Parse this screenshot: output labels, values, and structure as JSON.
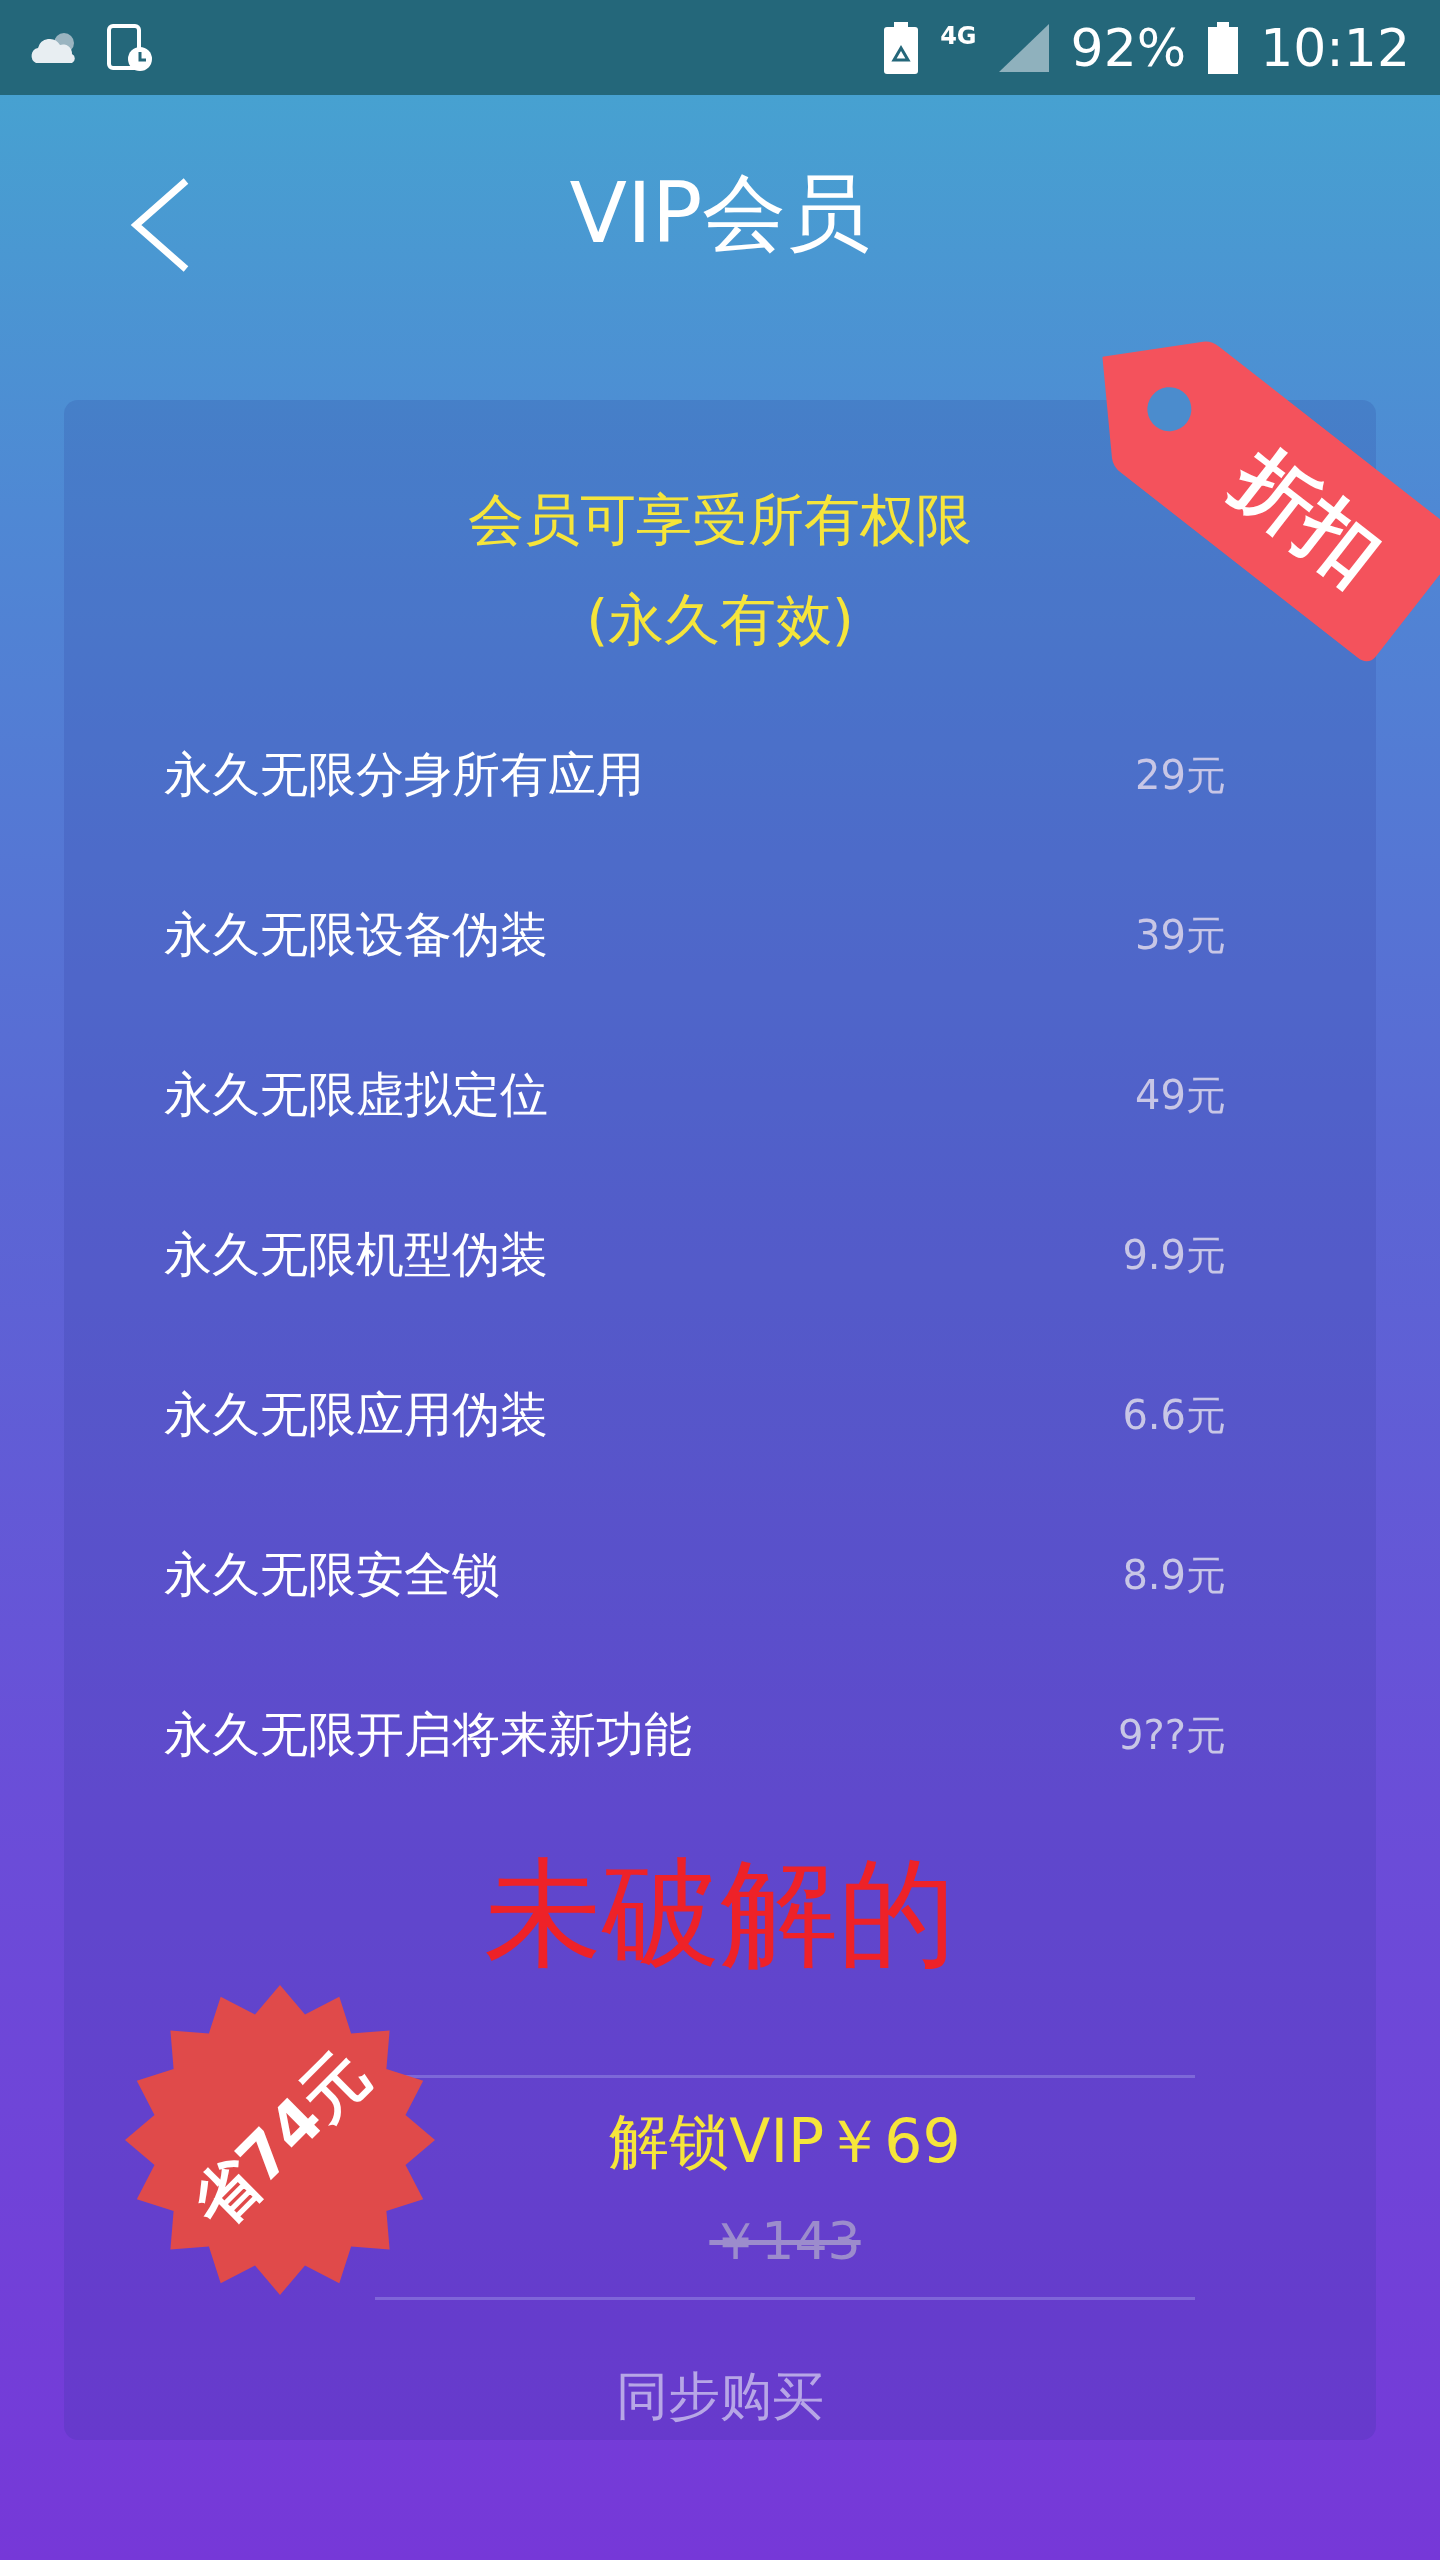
{
  "status_bar": {
    "network": "4G",
    "battery": "92%",
    "time": "10:12"
  },
  "header": {
    "title": "VIP会员"
  },
  "card": {
    "tag": "折扣",
    "heading": [
      "会员可享受所有权限",
      "(永久有效)"
    ],
    "features": [
      {
        "name": "永久无限分身所有应用",
        "price": "29元"
      },
      {
        "name": "永久无限设备伪装",
        "price": "39元"
      },
      {
        "name": "永久无限虚拟定位",
        "price": "49元"
      },
      {
        "name": "永久无限机型伪装",
        "price": "9.9元"
      },
      {
        "name": "永久无限应用伪装",
        "price": "6.6元"
      },
      {
        "name": "永久无限安全锁",
        "price": "8.9元"
      },
      {
        "name": "永久无限开启将来新功能",
        "price": "9??元"
      }
    ],
    "annotation": "未破解的",
    "savings_badge": "省74元",
    "buy_button": "解锁VIP￥69",
    "original_price": "￥143",
    "restore_link": "同步购买"
  }
}
